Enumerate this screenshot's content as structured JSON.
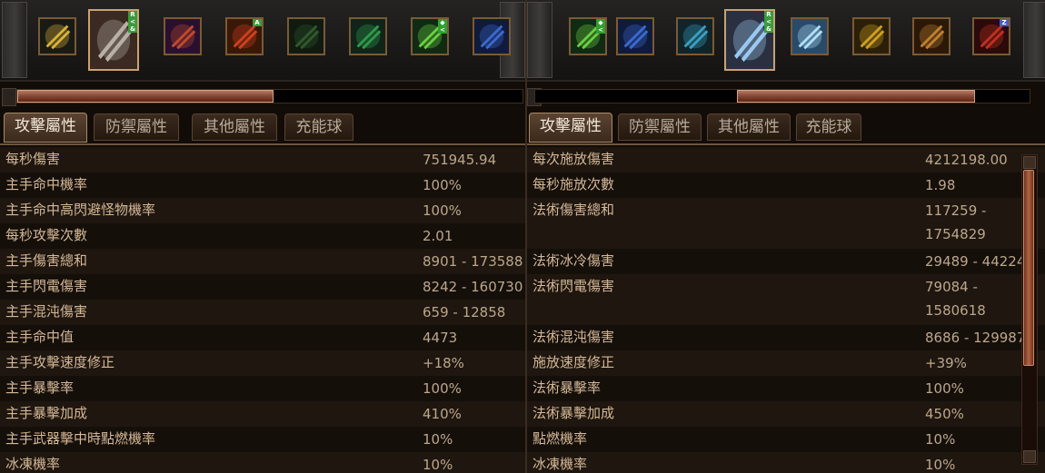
{
  "panels": [
    {
      "skills": [
        {
          "icon": "golden-sword-skill-icon",
          "color": "#d8b23a",
          "bg": "#1a1a14",
          "selected": false
        },
        {
          "icon": "spear-thrust-skill-icon",
          "color": "#b8b0a6",
          "bg": "#3a2a22",
          "selected": true,
          "marks": [
            "R",
            "<",
            "&"
          ],
          "mark_color": "#3c9a3c"
        },
        {
          "icon": "fire-aura-skill-icon",
          "color": "#c14a2a",
          "bg": "#2a1030",
          "selected": false
        },
        {
          "icon": "flame-shield-skill-icon",
          "color": "#d04020",
          "bg": "#3a1808",
          "selected": false,
          "marks": [
            "A"
          ],
          "mark_color": "#3c9a3c"
        },
        {
          "icon": "poison-strike-skill-icon",
          "color": "#2f5a2a",
          "bg": "#101a10",
          "selected": false
        },
        {
          "icon": "green-aura-skill-icon",
          "color": "#2f9a4a",
          "bg": "#10241a",
          "selected": false
        },
        {
          "icon": "wind-arrow-skill-icon",
          "color": "#6ad040",
          "bg": "#102a14",
          "selected": false,
          "marks": [
            "◆",
            "<"
          ],
          "mark_color": "#2fa02f"
        },
        {
          "icon": "blue-warrior-skill-icon",
          "color": "#3a6ad0",
          "bg": "#101a3a",
          "selected": false
        }
      ],
      "progress_fraction": 0.5,
      "tabs": [
        "攻擊屬性",
        "防禦屬性",
        "其他屬性",
        "充能球"
      ],
      "active_tab": 0,
      "stats": [
        {
          "label": "每秒傷害",
          "value": [
            "751945.94"
          ]
        },
        {
          "label": "主手命中機率",
          "value": [
            "100%"
          ]
        },
        {
          "label": "主手命中高閃避怪物機率",
          "value": [
            "100%"
          ]
        },
        {
          "label": "每秒攻擊次數",
          "value": [
            "2.01"
          ]
        },
        {
          "label": "主手傷害總和",
          "value": [
            "8901 - 173588"
          ]
        },
        {
          "label": "主手閃電傷害",
          "value": [
            "8242 - 160730"
          ]
        },
        {
          "label": "主手混沌傷害",
          "value": [
            "659 - 12858"
          ]
        },
        {
          "label": "主手命中值",
          "value": [
            "4473"
          ]
        },
        {
          "label": "主手攻擊速度修正",
          "value": [
            "+18%"
          ]
        },
        {
          "label": "主手暴擊率",
          "value": [
            "100%"
          ]
        },
        {
          "label": "主手暴擊加成",
          "value": [
            "410%"
          ]
        },
        {
          "label": "主手武器擊中時點燃機率",
          "value": [
            "10%"
          ]
        },
        {
          "label": "冰凍機率",
          "value": [
            "10%"
          ]
        }
      ]
    },
    {
      "skills": [
        {
          "icon": "wind-arrow-skill-icon",
          "color": "#6ad040",
          "bg": "#102a14",
          "selected": false,
          "marks": [
            "◆",
            "<"
          ],
          "mark_color": "#2fa02f"
        },
        {
          "icon": "arcane-hand-skill-icon",
          "color": "#3a6ad0",
          "bg": "#101a3a",
          "selected": false
        },
        {
          "icon": "frost-wraith-skill-icon",
          "color": "#3aa0c0",
          "bg": "#10242a",
          "selected": false
        },
        {
          "icon": "ice-spear-skill-icon",
          "color": "#9ac8f0",
          "bg": "#2a3040",
          "selected": true,
          "marks": [
            "R",
            "<",
            "&"
          ],
          "mark_color": "#3c9a3c"
        },
        {
          "icon": "storm-clone-skill-icon",
          "color": "#b0e0f8",
          "bg": "#2a4a6a",
          "selected": false
        },
        {
          "icon": "golden-strike-skill-icon",
          "color": "#d0a020",
          "bg": "#2a200a",
          "selected": false
        },
        {
          "icon": "beast-aura-skill-icon",
          "color": "#c08030",
          "bg": "#2a1808",
          "selected": false
        },
        {
          "icon": "crimson-mage-skill-icon",
          "color": "#c03020",
          "bg": "#2a0a0a",
          "selected": false,
          "marks": [
            "Z"
          ],
          "mark_color": "#4a5ad0"
        }
      ],
      "progress_fraction": 0.55,
      "tabs": [
        "攻擊屬性",
        "防禦屬性",
        "其他屬性",
        "充能球"
      ],
      "active_tab": 0,
      "stats": [
        {
          "label": "每次施放傷害",
          "value": [
            "4212198.00"
          ]
        },
        {
          "label": "每秒施放次數",
          "value": [
            "1.98"
          ]
        },
        {
          "label": "法術傷害總和",
          "value": [
            "117259 -",
            "1754829"
          ]
        },
        {
          "label": "法術冰冷傷害",
          "value": [
            "29489 - 44224"
          ]
        },
        {
          "label": "法術閃電傷害",
          "value": [
            "79084 -",
            "1580618"
          ]
        },
        {
          "label": "法術混沌傷害",
          "value": [
            "8686 - 129987"
          ]
        },
        {
          "label": "施放速度修正",
          "value": [
            "+39%"
          ]
        },
        {
          "label": "法術暴擊率",
          "value": [
            "100%"
          ]
        },
        {
          "label": "法術暴擊加成",
          "value": [
            "450%"
          ]
        },
        {
          "label": "點燃機率",
          "value": [
            "10%"
          ]
        },
        {
          "label": "冰凍機率",
          "value": [
            "10%"
          ]
        }
      ],
      "scroll_fraction": 0.7
    }
  ]
}
